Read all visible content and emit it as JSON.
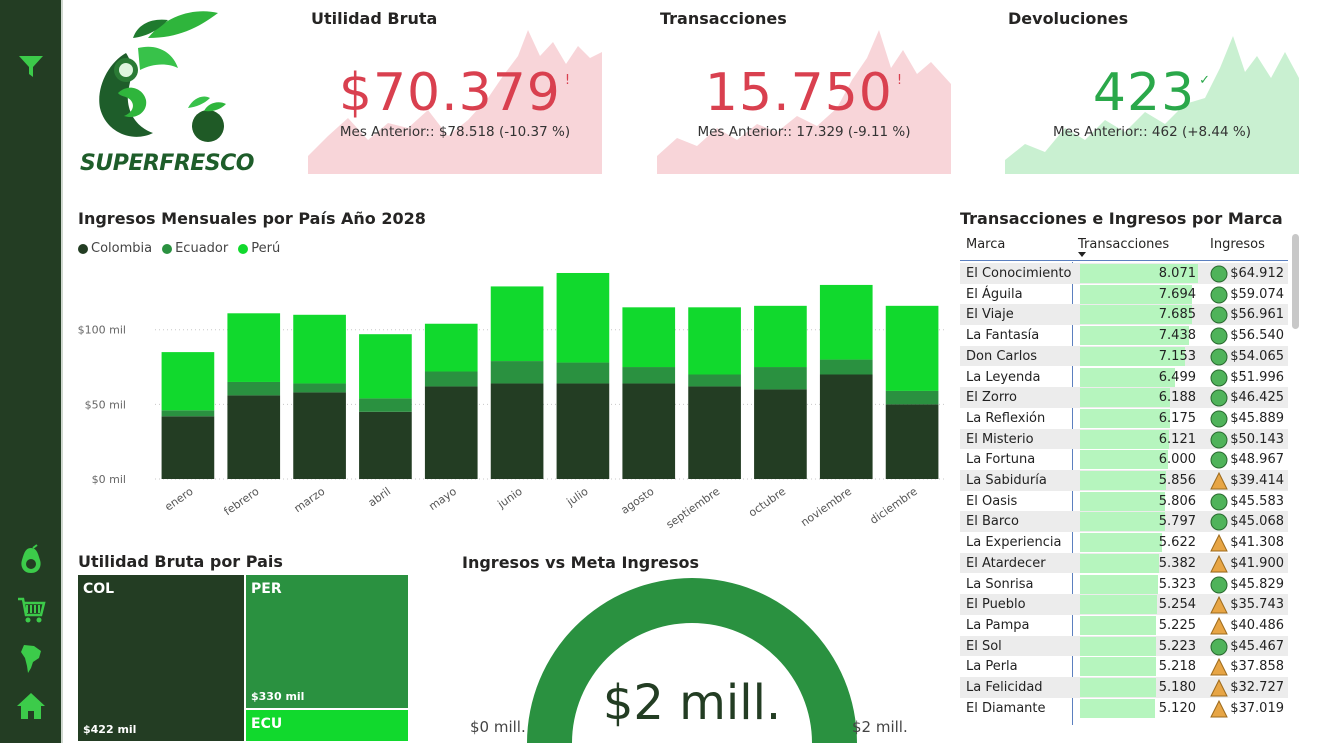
{
  "sidebar": {
    "icons": [
      "filter-icon",
      "avocado-icon",
      "cart-icon",
      "south-america-map-icon",
      "home-icon"
    ]
  },
  "brand": {
    "name": "SUPERFRESCO"
  },
  "colors": {
    "dark_green": "#233d23",
    "mid_green": "#2a9140",
    "light_green": "#11d92d",
    "red": "#d9404f",
    "pink_area": "#f8d5d9",
    "green_area": "#c9f0d1",
    "kpi_green": "#2aa84a"
  },
  "kpis": [
    {
      "title": "Utilidad Bruta",
      "value": "$70.379",
      "flag": "!",
      "sub": "Mes Anterior:: $78.518 (-10.37 %)",
      "status": "bad"
    },
    {
      "title": "Transacciones",
      "value": "15.750",
      "flag": "!",
      "sub": "Mes Anterior:: 17.329 (-9.11 %)",
      "status": "bad"
    },
    {
      "title": "Devoluciones",
      "value": "423",
      "flag": "✓",
      "sub": "Mes Anterior:: 462 (+8.44 %)",
      "status": "good"
    }
  ],
  "monthly": {
    "title": "Ingresos Mensuales por País Año 2028",
    "legend": [
      "Colombia",
      "Ecuador",
      "Perú"
    ]
  },
  "treemap": {
    "title": "Utilidad Bruta por Pais",
    "cells": [
      {
        "label": "COL",
        "value": "$422 mil"
      },
      {
        "label": "PER",
        "value": "$330 mil"
      },
      {
        "label": "ECU",
        "value": ""
      }
    ]
  },
  "gauge": {
    "title": "Ingresos vs Meta Ingresos",
    "value": "$2 mill.",
    "min": "$0 mill.",
    "max": "$2 mill.",
    "fill_fraction": 1.0
  },
  "table": {
    "title": "Transacciones e Ingresos por Marca",
    "headers": [
      "Marca",
      "Transacciones",
      "Ingresos"
    ],
    "rows": [
      {
        "marca": "El Conocimiento",
        "tx": "8.071",
        "txv": 8071,
        "ing": "$64.912",
        "ind": "circle"
      },
      {
        "marca": "El Águila",
        "tx": "7.694",
        "txv": 7694,
        "ing": "$59.074",
        "ind": "circle"
      },
      {
        "marca": "El Viaje",
        "tx": "7.685",
        "txv": 7685,
        "ing": "$56.961",
        "ind": "circle"
      },
      {
        "marca": "La Fantasía",
        "tx": "7.438",
        "txv": 7438,
        "ing": "$56.540",
        "ind": "circle"
      },
      {
        "marca": "Don Carlos",
        "tx": "7.153",
        "txv": 7153,
        "ing": "$54.065",
        "ind": "circle"
      },
      {
        "marca": "La Leyenda",
        "tx": "6.499",
        "txv": 6499,
        "ing": "$51.996",
        "ind": "circle"
      },
      {
        "marca": "El Zorro",
        "tx": "6.188",
        "txv": 6188,
        "ing": "$46.425",
        "ind": "circle"
      },
      {
        "marca": "La Reflexión",
        "tx": "6.175",
        "txv": 6175,
        "ing": "$45.889",
        "ind": "circle"
      },
      {
        "marca": "El Misterio",
        "tx": "6.121",
        "txv": 6121,
        "ing": "$50.143",
        "ind": "circle"
      },
      {
        "marca": "La Fortuna",
        "tx": "6.000",
        "txv": 6000,
        "ing": "$48.967",
        "ind": "circle"
      },
      {
        "marca": "La Sabiduría",
        "tx": "5.856",
        "txv": 5856,
        "ing": "$39.414",
        "ind": "triangle"
      },
      {
        "marca": "El Oasis",
        "tx": "5.806",
        "txv": 5806,
        "ing": "$45.583",
        "ind": "circle"
      },
      {
        "marca": "El Barco",
        "tx": "5.797",
        "txv": 5797,
        "ing": "$45.068",
        "ind": "circle"
      },
      {
        "marca": "La Experiencia",
        "tx": "5.622",
        "txv": 5622,
        "ing": "$41.308",
        "ind": "triangle"
      },
      {
        "marca": "El Atardecer",
        "tx": "5.382",
        "txv": 5382,
        "ing": "$41.900",
        "ind": "triangle"
      },
      {
        "marca": "La Sonrisa",
        "tx": "5.323",
        "txv": 5323,
        "ing": "$45.829",
        "ind": "circle"
      },
      {
        "marca": "El Pueblo",
        "tx": "5.254",
        "txv": 5254,
        "ing": "$35.743",
        "ind": "triangle"
      },
      {
        "marca": "La Pampa",
        "tx": "5.225",
        "txv": 5225,
        "ing": "$40.486",
        "ind": "triangle"
      },
      {
        "marca": "El Sol",
        "tx": "5.223",
        "txv": 5223,
        "ing": "$45.467",
        "ind": "circle"
      },
      {
        "marca": "La Perla",
        "tx": "5.218",
        "txv": 5218,
        "ing": "$37.858",
        "ind": "triangle"
      },
      {
        "marca": "La Felicidad",
        "tx": "5.180",
        "txv": 5180,
        "ing": "$32.727",
        "ind": "triangle"
      },
      {
        "marca": "El Diamante",
        "tx": "5.120",
        "txv": 5120,
        "ing": "$37.019",
        "ind": "triangle"
      }
    ]
  },
  "chart_data": {
    "type": "bar",
    "stacked": true,
    "title": "Ingresos Mensuales por País Año 2028",
    "categories": [
      "enero",
      "febrero",
      "marzo",
      "abril",
      "mayo",
      "junio",
      "julio",
      "agosto",
      "septiembre",
      "octubre",
      "noviembre",
      "diciembre"
    ],
    "series": [
      {
        "name": "Colombia",
        "color": "#233d23",
        "values": [
          42,
          56,
          58,
          45,
          62,
          64,
          64,
          64,
          62,
          60,
          70,
          50
        ]
      },
      {
        "name": "Ecuador",
        "color": "#2a9140",
        "values": [
          4,
          9,
          6,
          9,
          10,
          15,
          14,
          11,
          8,
          15,
          10,
          9
        ]
      },
      {
        "name": "Perú",
        "color": "#11d92d",
        "values": [
          39,
          46,
          46,
          43,
          32,
          50,
          60,
          40,
          45,
          41,
          50,
          57
        ]
      }
    ],
    "yticks": [
      "$0 mil",
      "$50 mil",
      "$100 mil"
    ],
    "ytick_values": [
      0,
      50,
      100
    ],
    "ylim": [
      0,
      140
    ],
    "grid": true,
    "legend": "top-left"
  }
}
